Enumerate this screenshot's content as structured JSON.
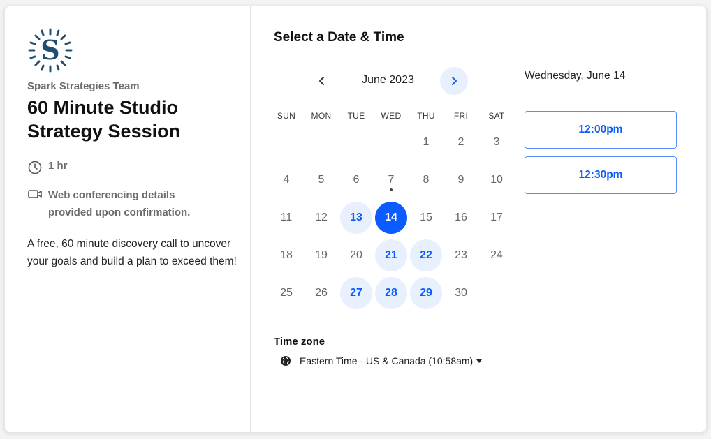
{
  "brand": {
    "logo_icon": "sun-s-logo-icon",
    "logo_color": "#1f4f6e"
  },
  "event": {
    "team_name": "Spark Strategies Team",
    "title": "60 Minute Studio Strategy Session",
    "duration": "1 hr",
    "conferencing": "Web conferencing details provided upon confirmation.",
    "description": "A free, 60 minute discovery call to uncover your goals and build a plan to exceed them!"
  },
  "calendar": {
    "heading": "Select a Date & Time",
    "month_label": "June 2023",
    "prev_icon": "chevron-left-icon",
    "next_icon": "chevron-right-icon",
    "weekdays": [
      "SUN",
      "MON",
      "TUE",
      "WED",
      "THU",
      "FRI",
      "SAT"
    ],
    "weeks": [
      [
        "",
        "",
        "",
        "",
        "1",
        "2",
        "3"
      ],
      [
        "4",
        "5",
        "6",
        "7",
        "8",
        "9",
        "10"
      ],
      [
        "11",
        "12",
        "13",
        "14",
        "15",
        "16",
        "17"
      ],
      [
        "18",
        "19",
        "20",
        "21",
        "22",
        "23",
        "24"
      ],
      [
        "25",
        "26",
        "27",
        "28",
        "29",
        "30",
        ""
      ]
    ],
    "available_days": [
      "13",
      "21",
      "22",
      "27",
      "28",
      "29"
    ],
    "selected_day": "14",
    "today": "7",
    "accent_color": "#0b5cff",
    "available_bg": "#e8f0fe"
  },
  "timezone": {
    "label": "Time zone",
    "value": "Eastern Time - US & Canada (10:58am)",
    "icon": "globe-icon"
  },
  "times": {
    "date_title": "Wednesday, June 14",
    "slots": [
      "12:00pm",
      "12:30pm"
    ]
  }
}
